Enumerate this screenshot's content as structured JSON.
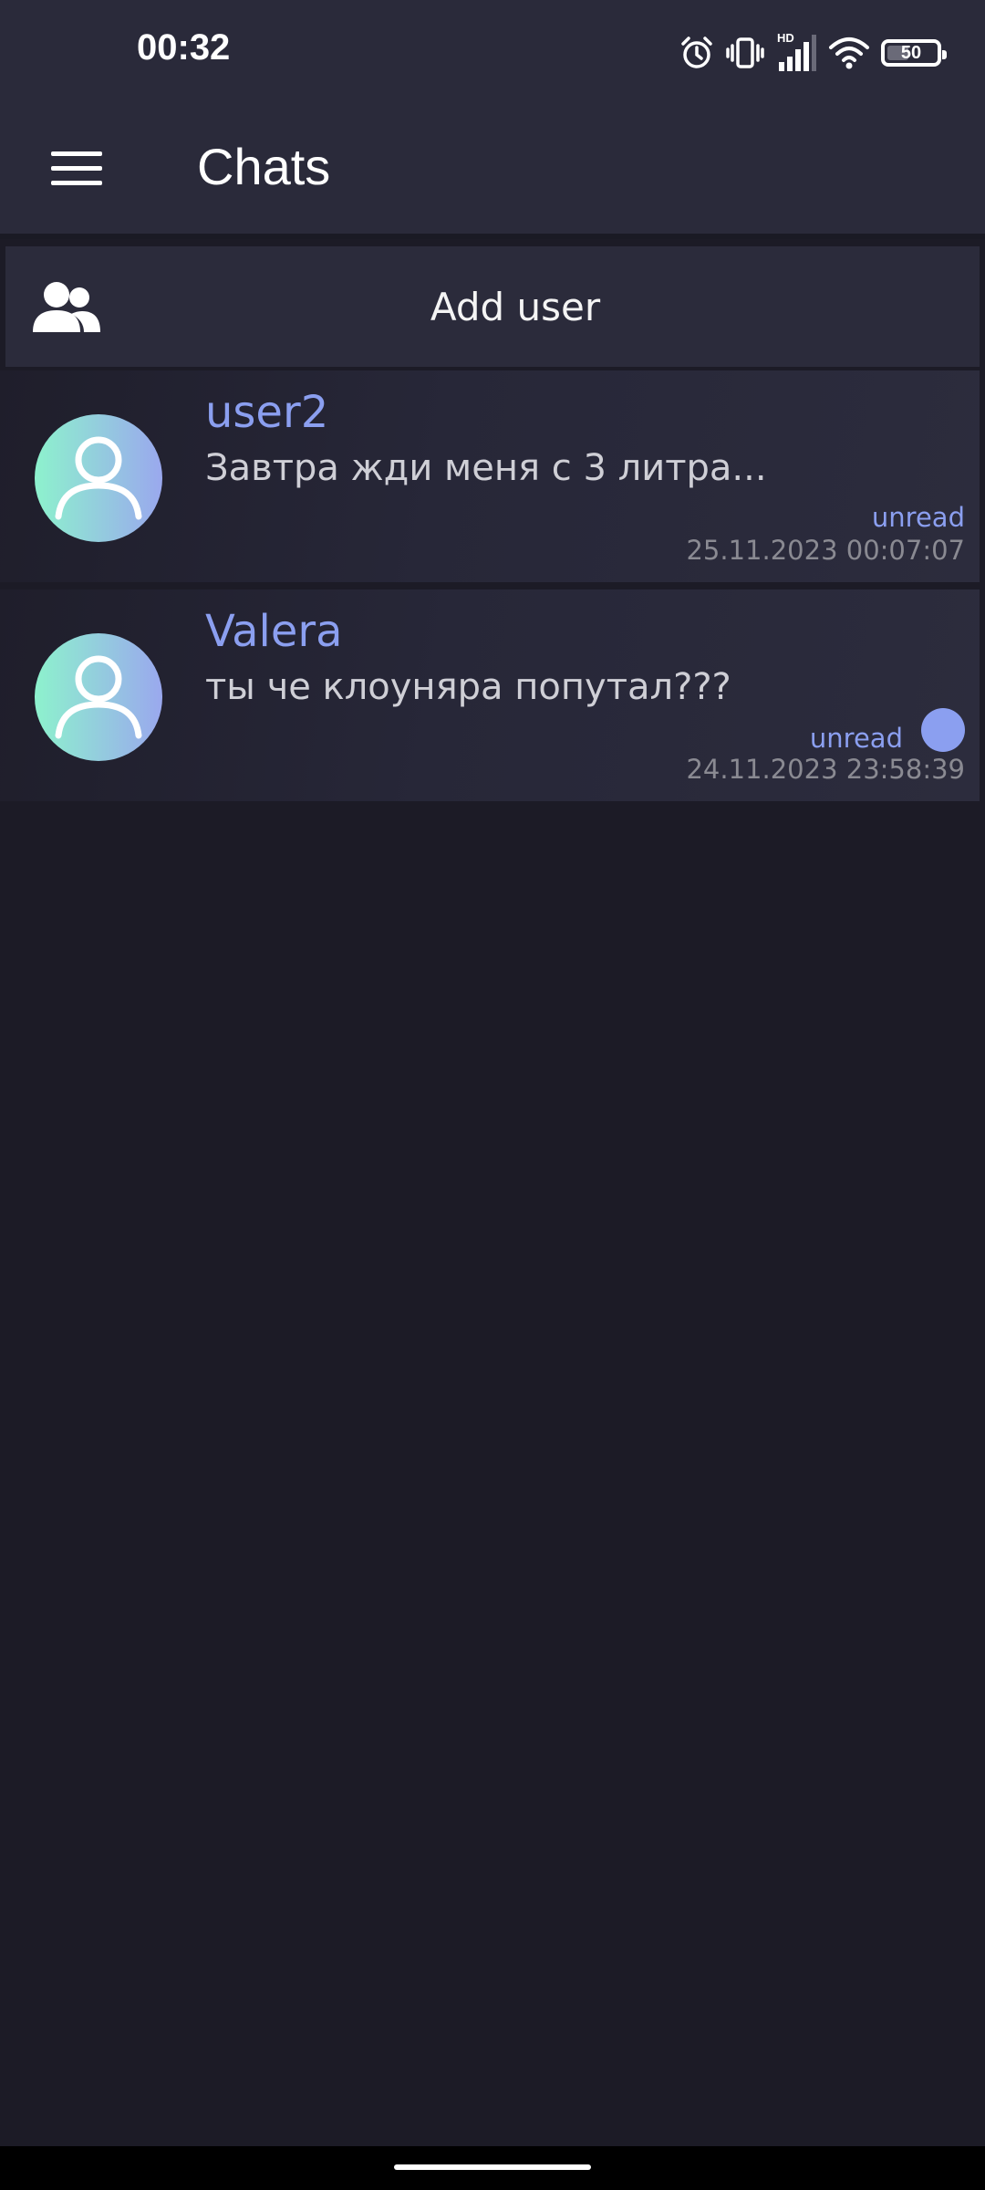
{
  "status_bar": {
    "time": "00:32",
    "icons": [
      "alarm-icon",
      "vibrate-icon",
      "signal-hd-icon",
      "wifi-icon"
    ],
    "battery": {
      "level_label": "50",
      "level_fraction": 0.5
    }
  },
  "app_bar": {
    "menu_icon": "hamburger-menu-icon",
    "title": "Chats"
  },
  "add_user": {
    "icon": "users-icon",
    "label": "Add user"
  },
  "chats": [
    {
      "name": "user2",
      "preview": "Завтра жди меня с 3 литра...",
      "status": "unread",
      "timestamp": "25.11.2023 00:07:07",
      "has_unread_dot": false
    },
    {
      "name": "Valera",
      "preview": "ты че клоуняра попутал???",
      "status": "unread",
      "timestamp": "24.11.2023 23:58:39",
      "has_unread_dot": true
    }
  ],
  "colors": {
    "accent": "#8b9ff0",
    "background": "#1c1b26",
    "bar": "#2a2a3a",
    "avatar_gradient_start": "#8df2cd",
    "avatar_gradient_end": "#9aa8ee"
  }
}
